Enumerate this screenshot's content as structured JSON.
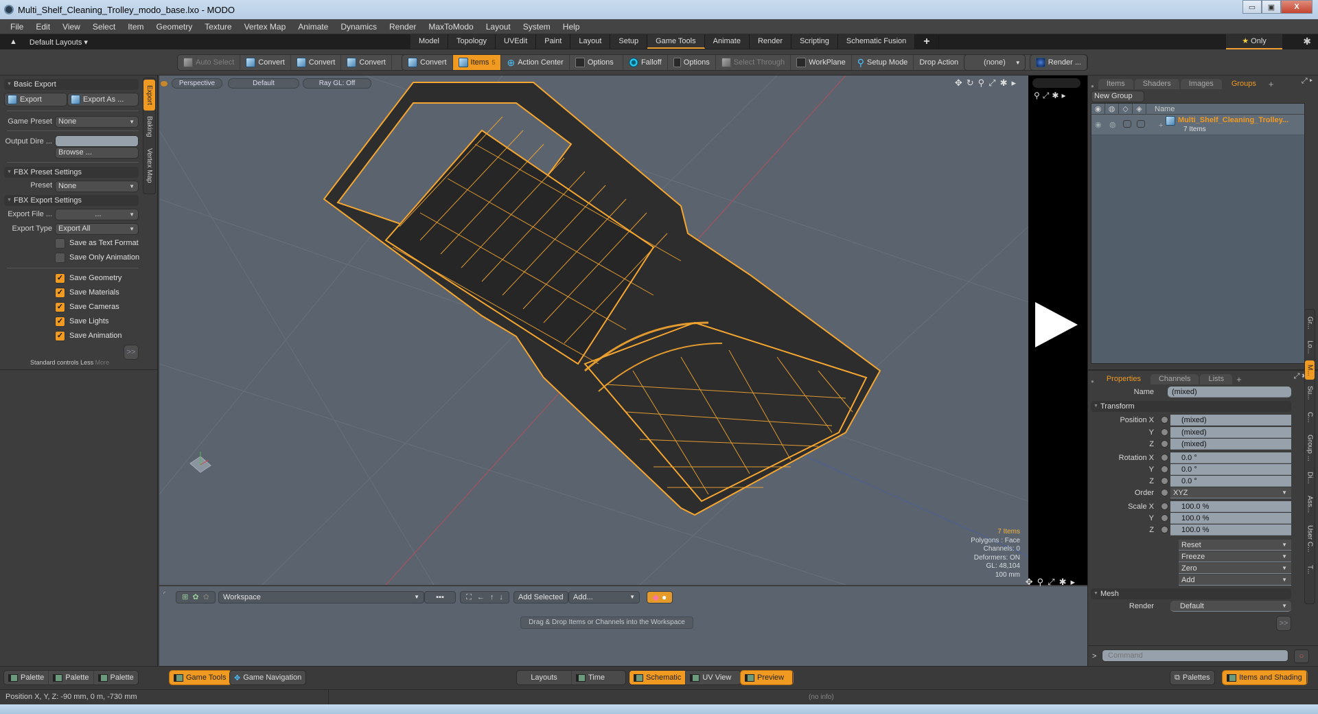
{
  "window": {
    "title": "Multi_Shelf_Cleaning_Trolley_modo_base.lxo - MODO",
    "minimize": "▭",
    "maximize": "▣",
    "close": "X"
  },
  "menu": [
    "File",
    "Edit",
    "View",
    "Select",
    "Item",
    "Geometry",
    "Texture",
    "Vertex Map",
    "Animate",
    "Dynamics",
    "Render",
    "MaxToModo",
    "Layout",
    "System",
    "Help"
  ],
  "layout_bar": {
    "default_layouts": "Default Layouts ▾",
    "tabs": [
      "Model",
      "Topology",
      "UVEdit",
      "Paint",
      "Layout",
      "Setup",
      "Game Tools",
      "Animate",
      "Render",
      "Scripting",
      "Schematic Fusion"
    ],
    "active_tab": "Game Tools",
    "plus": "+",
    "only": "Only",
    "star": "★"
  },
  "toolbar": {
    "auto_select": "Auto Select",
    "convert": [
      "Convert",
      "Convert",
      "Convert",
      "Convert"
    ],
    "items": "Items",
    "items_count": "5",
    "action_center": "Action Center",
    "options1": "Options",
    "falloff": "Falloff",
    "options2": "Options",
    "select_through": "Select Through",
    "workplane": "WorkPlane",
    "setup_mode": "Setup Mode",
    "drop_action_label": "Drop Action",
    "drop_action_value": "(none)",
    "render": "Render ..."
  },
  "left_panel": {
    "basic_export": "Basic Export",
    "export_btn": "Export",
    "export_as_btn": "Export As ...",
    "game_preset_label": "Game Preset",
    "game_preset_value": "None",
    "output_dir_label": "Output Dire ...",
    "output_dir_value": "",
    "browse": "Browse ...",
    "fbx_preset": "FBX Preset Settings",
    "preset_label": "Preset",
    "preset_value": "None",
    "fbx_export": "FBX Export Settings",
    "export_file_label": "Export File ...",
    "export_file_value": "...",
    "export_type_label": "Export Type",
    "export_type_value": "Export All",
    "checks": [
      {
        "label": "Save as Text Format",
        "checked": false
      },
      {
        "label": "Save Only Animation",
        "checked": false
      },
      {
        "label": "Save Geometry",
        "checked": true
      },
      {
        "label": "Save Materials",
        "checked": true
      },
      {
        "label": "Save Cameras",
        "checked": true
      },
      {
        "label": "Save Lights",
        "checked": true
      },
      {
        "label": "Save Animation",
        "checked": true
      }
    ],
    "more_btn": ">>",
    "standard_controls": "Standard controls",
    "less": "Less",
    "more": "More",
    "vtabs": [
      "Export",
      "Baking",
      "Vertex Map"
    ]
  },
  "viewport": {
    "view": "Perspective",
    "shading": "Default",
    "raygl": "Ray GL: Off",
    "hud": {
      "items": "7 Items",
      "polygons": "Polygons : Face",
      "channels": "Channels: 0",
      "deformers": "Deformers: ON",
      "gl": "GL: 48,104",
      "scale": "100 mm"
    },
    "model_color": "#f5a630"
  },
  "workspace": {
    "workspace_value": "Workspace",
    "add_selected": "Add Selected",
    "add": "Add...",
    "drag_msg": "Drag & Drop Items or Channels into the Workspace"
  },
  "right_panel": {
    "top_tabs": [
      "Items",
      "Shaders",
      "Images",
      "Groups"
    ],
    "top_active": "Groups",
    "new_group": "New Group",
    "name_col": "Name",
    "group_name": "Multi_Shelf_Cleaning_Trolley...",
    "group_count": "7 Items",
    "prop_tabs": [
      "Properties",
      "Channels",
      "Lists"
    ],
    "prop_active": "Properties",
    "name_label": "Name",
    "name_value": "(mixed)",
    "transform": "Transform",
    "position": {
      "label": "Position X",
      "x": "(mixed)",
      "y": "(mixed)",
      "z": "(mixed)"
    },
    "rotation": {
      "label": "Rotation X",
      "x": "0.0 °",
      "y": "0.0 °",
      "z": "0.0 °"
    },
    "order_label": "Order",
    "order_value": "XYZ",
    "scale": {
      "label": "Scale X",
      "x": "100.0 %",
      "y": "100.0 %",
      "z": "100.0 %"
    },
    "axis_y": "Y",
    "axis_z": "Z",
    "actions": [
      "Reset",
      "Freeze",
      "Zero",
      "Add"
    ],
    "mesh": "Mesh",
    "render_label": "Render",
    "render_value": "Default",
    "more_btn": ">>",
    "command_placeholder": "Command",
    "vtabs": [
      "Gr...",
      "Lo...",
      "M...",
      "Su...",
      "C...",
      "Group ...",
      "Di...",
      "Ass...",
      "User C...",
      "T..."
    ]
  },
  "bottom_bar": {
    "palettes": [
      "Palette",
      "Palette",
      "Palette"
    ],
    "game_tools": "Game Tools",
    "game_navigation": "Game Navigation",
    "layouts": "Layouts",
    "time": "Time",
    "schematic": "Schematic",
    "uv_view": "UV View",
    "preview": "Preview",
    "palettes_btn": "Palettes",
    "items_shading": "Items and Shading"
  },
  "status": {
    "position": "Position X, Y, Z:  -90 mm, 0 m, -730 mm",
    "info": "(no info)"
  }
}
